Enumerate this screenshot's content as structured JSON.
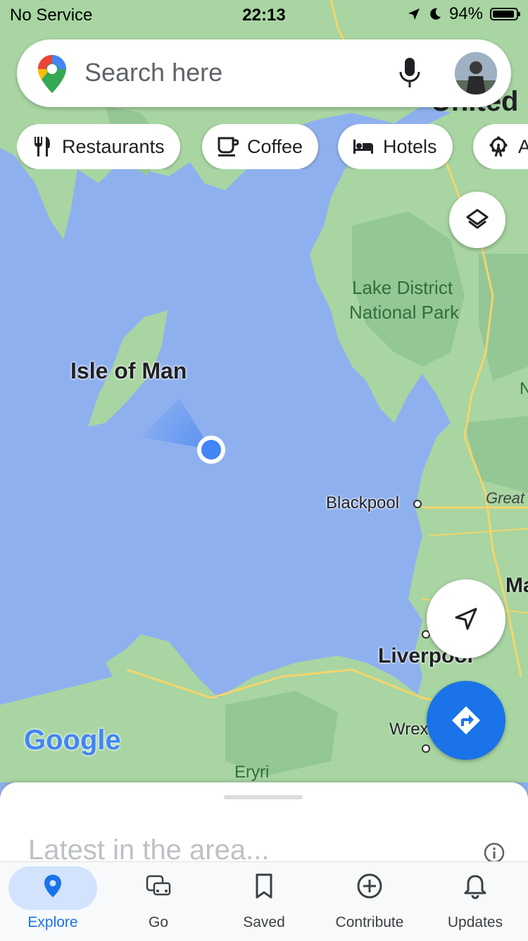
{
  "status_bar": {
    "carrier": "No Service",
    "time": "22:13",
    "battery": "94%",
    "icons": [
      "location-arrow-icon",
      "moon-icon",
      "battery-icon"
    ]
  },
  "search": {
    "placeholder": "Search here",
    "icons": [
      "google-maps-pin-icon",
      "microphone-icon",
      "user-avatar"
    ]
  },
  "chips": [
    {
      "label": "Restaurants",
      "icon": "fork-knife-icon"
    },
    {
      "label": "Coffee",
      "icon": "coffee-cup-icon"
    },
    {
      "label": "Hotels",
      "icon": "bed-icon"
    },
    {
      "label": "A",
      "icon": "ferris-wheel-icon"
    }
  ],
  "map": {
    "labels": {
      "isle_of_man": "Isle of Man",
      "lake_district_1": "Lake District",
      "lake_district_2": "National Park",
      "blackpool": "Blackpool",
      "liverpool": "Liverpool",
      "wrexham": "Wrex",
      "eryri": "Eryri",
      "great": "Great",
      "ma": "Ma",
      "n": "N",
      "united": "United",
      "google": "Google"
    },
    "colors": {
      "water": "#8fb0ef",
      "land": "#a8d5a2",
      "forest": "#94c796",
      "road": "#f5d56b",
      "location": "#4285f4"
    }
  },
  "buttons": {
    "layers": "layers-icon",
    "my_location": "navigation-arrow-icon",
    "directions": "directions-icon"
  },
  "sheet": {
    "title": "Latest in the area...",
    "info_icon": "info-icon"
  },
  "bottom_nav": [
    {
      "label": "Explore",
      "icon": "explore-pin-icon",
      "active": true
    },
    {
      "label": "Go",
      "icon": "commute-icon",
      "active": false
    },
    {
      "label": "Saved",
      "icon": "bookmark-icon",
      "active": false
    },
    {
      "label": "Contribute",
      "icon": "add-circle-icon",
      "active": false
    },
    {
      "label": "Updates",
      "icon": "bell-icon",
      "active": false
    }
  ]
}
